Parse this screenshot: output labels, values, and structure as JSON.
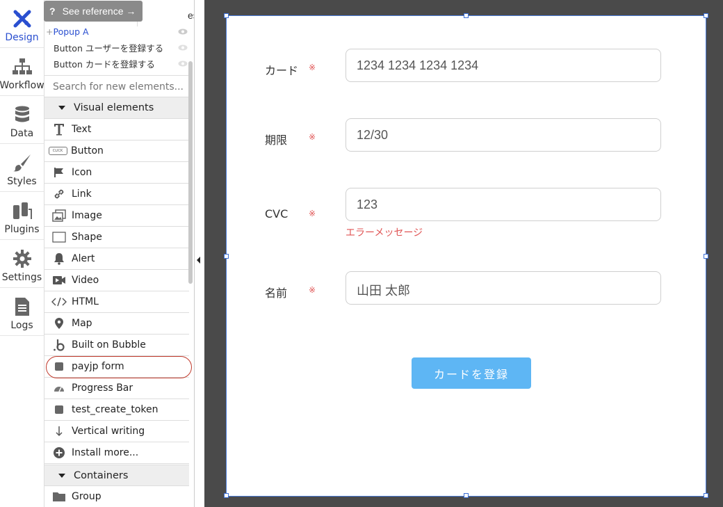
{
  "sidebar": {
    "items": [
      {
        "label": "Design",
        "icon": "design-icon",
        "active": true
      },
      {
        "label": "Workflow",
        "icon": "workflow-icon"
      },
      {
        "label": "Data",
        "icon": "database-icon"
      },
      {
        "label": "Styles",
        "icon": "brush-icon"
      },
      {
        "label": "Plugins",
        "icon": "plug-icon"
      },
      {
        "label": "Settings",
        "icon": "gear-icon"
      },
      {
        "label": "Logs",
        "icon": "document-icon"
      }
    ]
  },
  "palette": {
    "tooltip": "See reference →",
    "tooltip_mark": "?",
    "tab_responsive": "esponsive",
    "tree": {
      "popup": "Popup A",
      "popup_prefix": "+",
      "button1": "Button ユーザーを登録する",
      "button2": "Button カードを登録する"
    },
    "search_placeholder": "Search for new elements...",
    "visual_header": "Visual elements",
    "elements": [
      {
        "label": "Text",
        "icon": "text-icon"
      },
      {
        "label": "Button",
        "icon": "button-icon",
        "icon_text": "CLICK"
      },
      {
        "label": "Icon",
        "icon": "flag-icon"
      },
      {
        "label": "Link",
        "icon": "link-icon"
      },
      {
        "label": "Image",
        "icon": "image-icon"
      },
      {
        "label": "Shape",
        "icon": "shape-icon"
      },
      {
        "label": "Alert",
        "icon": "bell-icon"
      },
      {
        "label": "Video",
        "icon": "video-icon"
      },
      {
        "label": "HTML",
        "icon": "code-icon"
      },
      {
        "label": "Map",
        "icon": "map-pin-icon"
      },
      {
        "label": "Built on Bubble",
        "icon": "bubble-logo-icon"
      },
      {
        "label": "payjp form",
        "icon": "square-icon",
        "highlighted": true
      },
      {
        "label": "Progress Bar",
        "icon": "gauge-icon"
      },
      {
        "label": "test_create_token",
        "icon": "square-icon"
      },
      {
        "label": "Vertical writing",
        "icon": "arrow-down-icon"
      },
      {
        "label": "Install more...",
        "icon": "plus-circle-icon"
      }
    ],
    "containers_header": "Containers",
    "containers": [
      {
        "label": "Group",
        "icon": "folder-icon"
      }
    ]
  },
  "form": {
    "card_label": "カード",
    "card_value": "1234 1234 1234 1234",
    "expiry_label": "期限",
    "expiry_value": "12/30",
    "cvc_label": "CVC",
    "cvc_value": "123",
    "cvc_error": "エラーメッセージ",
    "name_label": "名前",
    "name_value": "山田 太郎",
    "required_mark": "※",
    "submit_label": "カードを登録"
  },
  "colors": {
    "accent_blue": "#2a4fd0",
    "submit_button": "#5eb6f4",
    "error_red": "#e05555",
    "highlight_ring": "#c0392b",
    "canvas_bg": "#4a4a4a"
  }
}
